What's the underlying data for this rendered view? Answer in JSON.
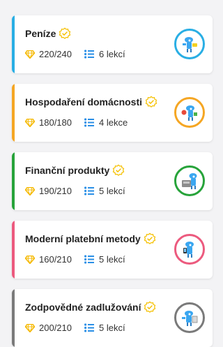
{
  "courses": [
    {
      "title": "Peníze",
      "score": "220/240",
      "lessons": "6 lekcí",
      "accent": "#29aee4",
      "icon": "mascot-money-icon"
    },
    {
      "title": "Hospodaření domácnosti",
      "score": "180/180",
      "lessons": "4 lekce",
      "accent": "#f5a623",
      "icon": "mascot-household-icon"
    },
    {
      "title": "Finanční produkty",
      "score": "190/210",
      "lessons": "5 lekcí",
      "accent": "#27a33a",
      "icon": "mascot-products-icon"
    },
    {
      "title": "Moderní platební metody",
      "score": "160/210",
      "lessons": "5 lekcí",
      "accent": "#ec5a7e",
      "icon": "mascot-payment-icon"
    },
    {
      "title": "Zodpovědné zadlužování",
      "score": "200/210",
      "lessons": "5 lekcí",
      "accent": "#7a7a7a",
      "icon": "mascot-debt-icon"
    }
  ],
  "colors": {
    "gem": "#f5b800",
    "list_icon": "#2a8fe6",
    "verified": "#f5c000",
    "mascot": "#3aa6f0"
  }
}
